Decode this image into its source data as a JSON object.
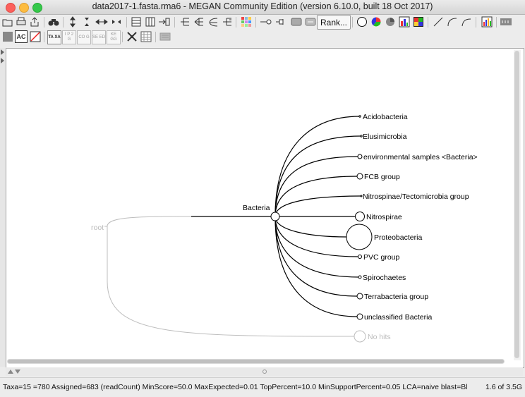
{
  "window": {
    "title": "data2017-1.fasta.rma6 - MEGAN Community Edition (version 6.10.0, built 18 Oct 2017)"
  },
  "toolbar": {
    "rank_label": "Rank...",
    "ac_label": "AC",
    "taxa_label": "TA XA",
    "ip_label": "I P 2 G",
    "cog_label": "CO G",
    "seed_label": "SE ED",
    "kegg_label": "KE GG"
  },
  "tree": {
    "root_label": "root",
    "bacteria_label": "Bacteria",
    "nohits_label": "No hits",
    "leaves": [
      "Acidobacteria",
      "Elusimicrobia",
      "environmental samples <Bacteria>",
      "FCB group",
      "Nitrospinae/Tectomicrobia group",
      "Nitrospirae",
      "Proteobacteria",
      "PVC group",
      "Spirochaetes",
      "Terrabacteria group",
      "unclassified Bacteria"
    ]
  },
  "status": {
    "text": "Taxa=15    =780 Assigned=683 (readCount) MinScore=50.0 MaxExpected=0.01 TopPercent=10.0 MinSupportPercent=0.05 LCA=naive blast=Bl",
    "memory": "1.6 of 3.5G"
  }
}
